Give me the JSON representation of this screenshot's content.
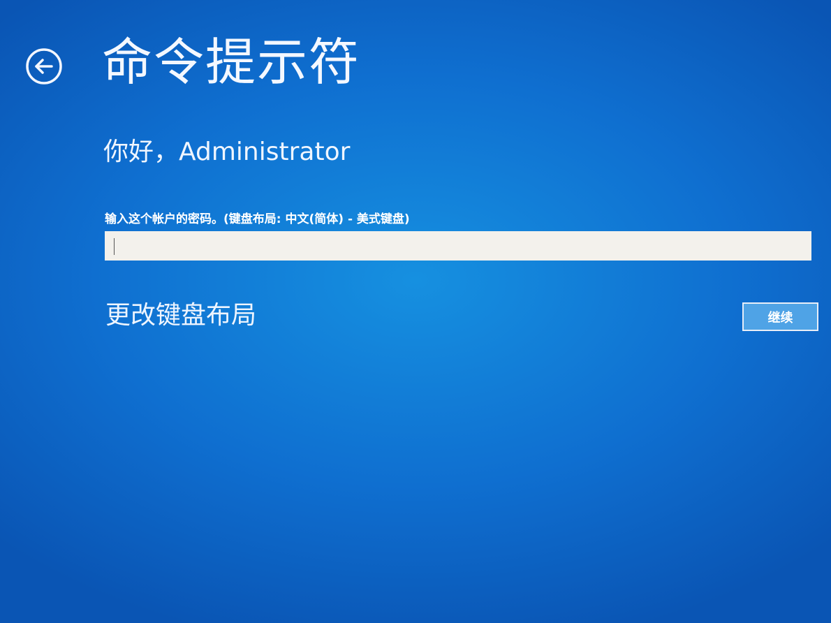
{
  "header": {
    "title": "命令提示符",
    "back_icon": "back-arrow-icon"
  },
  "greeting": "你好，Administrator",
  "password_prompt": {
    "label": "输入这个帐户的密码。(键盘布局: 中文(简体) - 美式键盘)",
    "value": ""
  },
  "actions": {
    "change_layout_label": "更改键盘布局",
    "continue_label": "继续"
  },
  "colors": {
    "background": "#0f6fd0",
    "input_background": "#f3f1ec",
    "button_background": "#4fa3e6",
    "text": "#ffffff"
  }
}
